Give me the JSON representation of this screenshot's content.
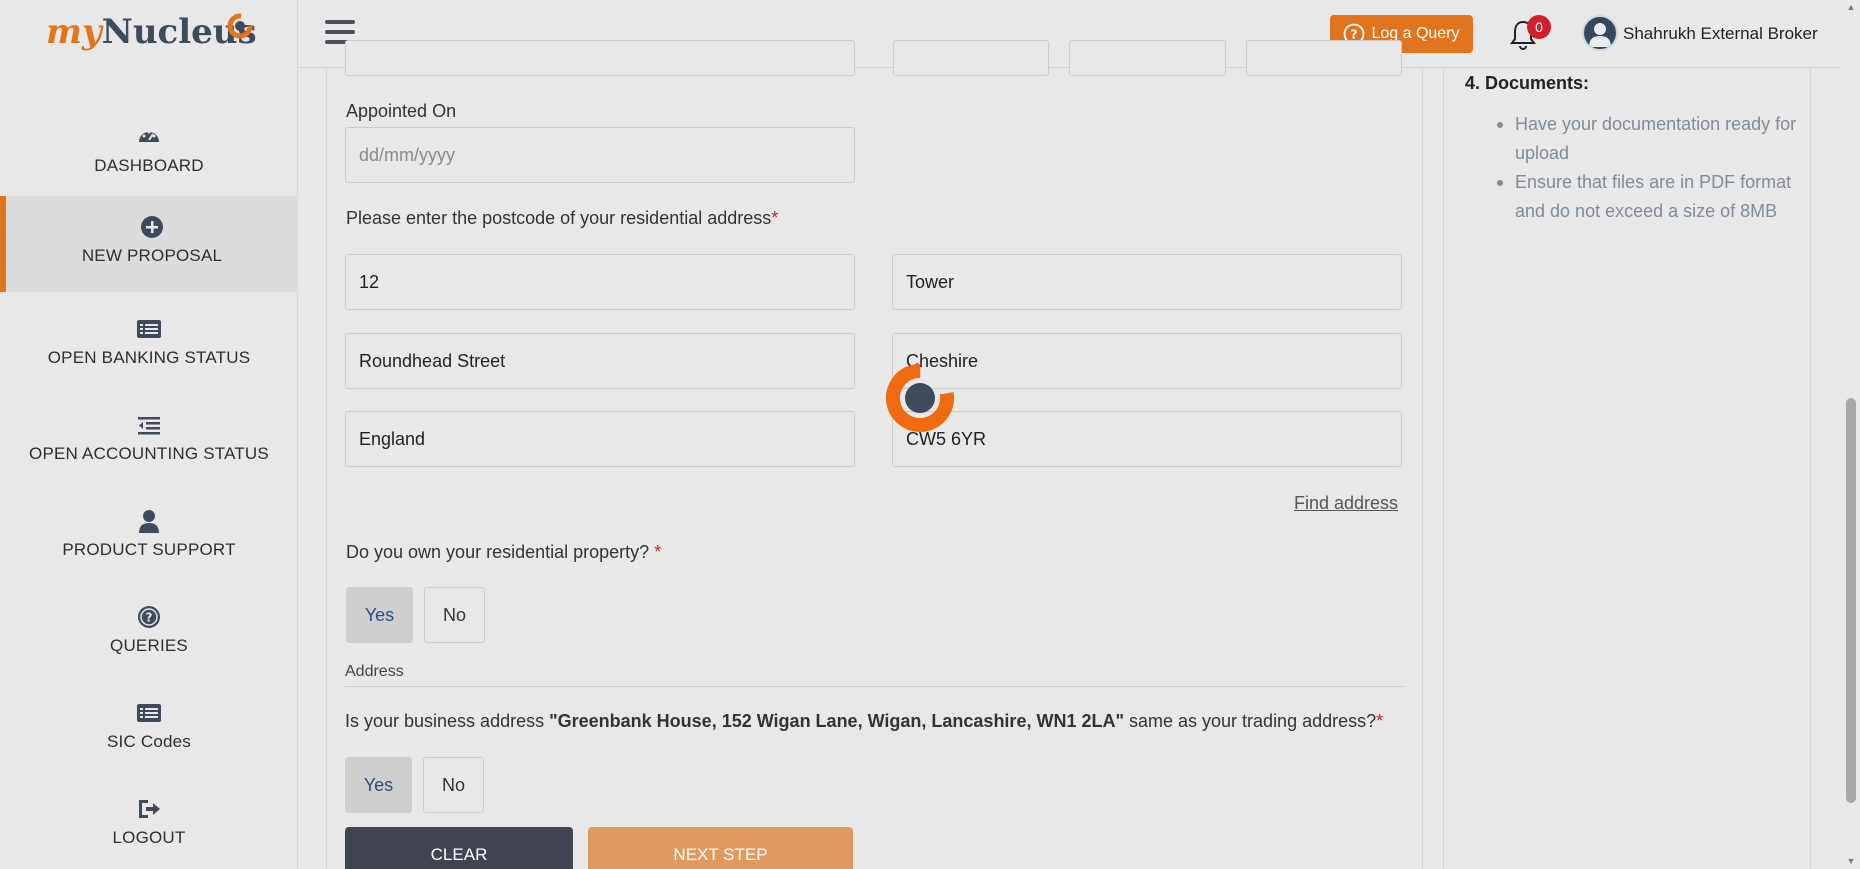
{
  "brand": {
    "logo_my": "my",
    "logo_nucleus": "Nucleus",
    "accent_color": "#e2741d",
    "dark_color": "#3f4a5a"
  },
  "sidebar": {
    "items": [
      {
        "label": "DASHBOARD",
        "icon": "dashboard-icon"
      },
      {
        "label": "NEW PROPOSAL",
        "icon": "plus-circle-icon"
      },
      {
        "label": "OPEN BANKING STATUS",
        "icon": "list-icon"
      },
      {
        "label": "OPEN ACCOUNTING STATUS",
        "icon": "outdent-icon"
      },
      {
        "label": "PRODUCT SUPPORT",
        "icon": "user-icon"
      },
      {
        "label": "QUERIES",
        "icon": "question-circle-icon"
      },
      {
        "label": "SIC Codes",
        "icon": "list-icon"
      },
      {
        "label": "LOGOUT",
        "icon": "logout-icon"
      }
    ]
  },
  "header": {
    "log_query_label": "Log a Query",
    "notification_count": "0",
    "user_name": "Shahrukh External Broker"
  },
  "form": {
    "appointed_on_label": "Appointed On",
    "appointed_on_placeholder": "dd/mm/yyyy",
    "postcode_label": "Please enter the postcode of your residential address",
    "required_mark": "*",
    "address_fields": [
      "12",
      "Tower",
      "Roundhead Street",
      "Cheshire",
      "England",
      "CW5 6YR"
    ],
    "find_address_label": "Find address",
    "own_property_label": "Do you own your residential property?",
    "own_property_options": [
      "Yes",
      "No"
    ],
    "own_property_selected": "Yes",
    "address_section_title": "Address",
    "business_question_prefix": "Is your business address ",
    "business_address": "\"Greenbank House, 152 Wigan Lane, Wigan, Lancashire, WN1 2LA\"",
    "business_question_suffix": " same as your trading address?",
    "business_options": [
      "Yes",
      "No"
    ],
    "business_selected": "Yes",
    "clear_label": "CLEAR",
    "next_label": "NEXT STEP"
  },
  "documents": {
    "title": "4. Documents:",
    "items": [
      "Have your documentation ready for upload",
      "Ensure that files are in PDF format and do not exceed a size of 8MB"
    ]
  }
}
